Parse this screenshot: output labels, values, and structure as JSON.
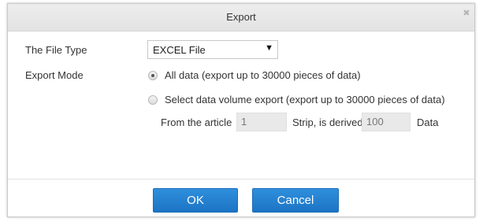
{
  "dialog": {
    "title": "Export"
  },
  "form": {
    "file_type_label": "The File Type",
    "file_type_value": "EXCEL File",
    "export_mode_label": "Export Mode",
    "option_all": "All data (export up to 30000 pieces of data)",
    "option_volume": "Select data volume export (export up to 30000 pieces of data)",
    "option_all_checked": true,
    "range": {
      "from_label": "From the article",
      "from_value": "1",
      "middle_label": "Strip, is derived",
      "count_value": "100",
      "end_label": "Data"
    }
  },
  "buttons": {
    "ok": "OK",
    "cancel": "Cancel"
  },
  "colors": {
    "primary_button": "#2080d0",
    "titlebar": "#e8e8e8"
  },
  "icons": {
    "close": "close-icon",
    "dropdown": "chevron-down-icon"
  }
}
